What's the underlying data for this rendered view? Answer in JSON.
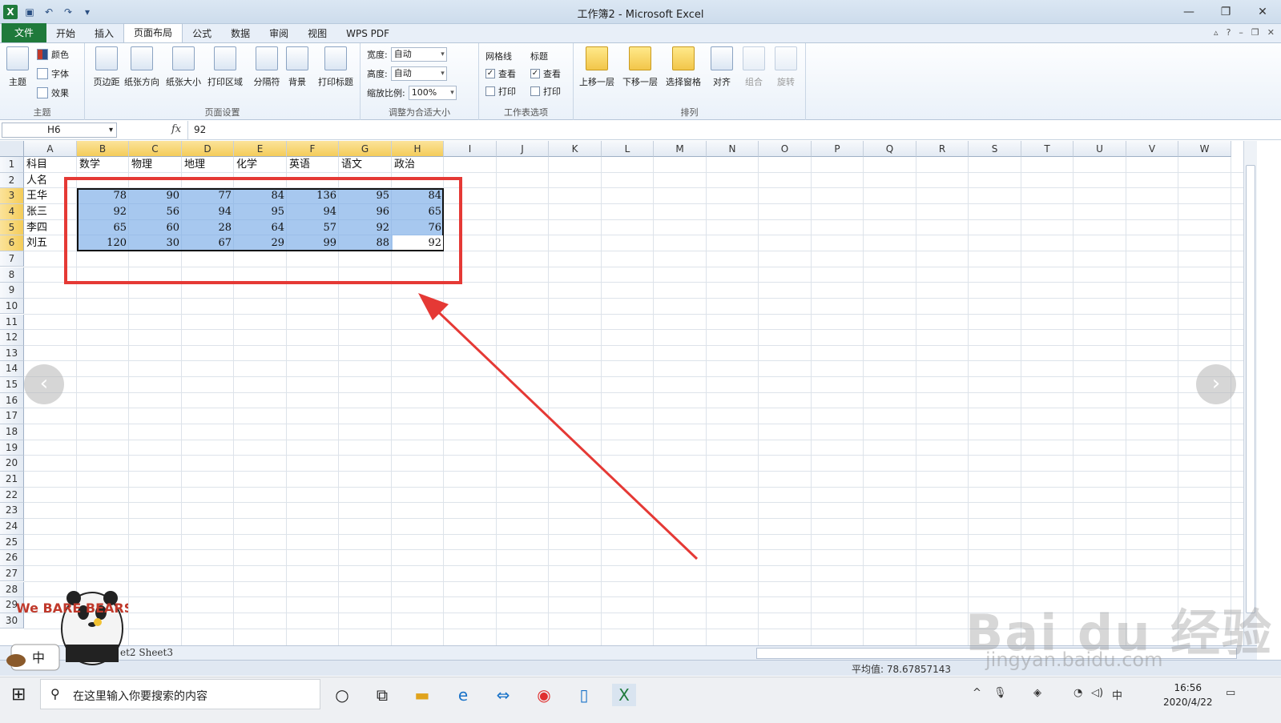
{
  "window": {
    "title": "工作簿2 - Microsoft Excel"
  },
  "ribbon_tabs": [
    "文件",
    "开始",
    "插入",
    "页面布局",
    "公式",
    "数据",
    "审阅",
    "视图",
    "WPS PDF"
  ],
  "ribbon": {
    "theme": {
      "big_label": "主题",
      "colors": "颜色",
      "fonts": "字体",
      "effects": "效果",
      "group_label": "主题"
    },
    "page_setup": {
      "buttons": [
        "页边距",
        "纸张方向",
        "纸张大小",
        "打印区域",
        "分隔符",
        "背景",
        "打印标题"
      ],
      "group_label": "页面设置"
    },
    "scale": {
      "width_label": "宽度:",
      "width_value": "自动",
      "height_label": "高度:",
      "height_value": "自动",
      "scale_label": "缩放比例:",
      "scale_value": "100%",
      "group_label": "调整为合适大小"
    },
    "sheet_options": {
      "gridlines": "网格线",
      "headings": "标题",
      "view": "查看",
      "print": "打印",
      "group_label": "工作表选项"
    },
    "arrange": {
      "buttons": [
        "上移一层",
        "下移一层",
        "选择窗格",
        "对齐",
        "组合",
        "旋转"
      ],
      "group_label": "排列"
    }
  },
  "formula_bar": {
    "name_box": "H6",
    "fx": "fx",
    "value": "92"
  },
  "columns": [
    "A",
    "B",
    "C",
    "D",
    "E",
    "F",
    "G",
    "H",
    "I",
    "J",
    "K",
    "L",
    "M",
    "N",
    "O",
    "P",
    "Q",
    "R",
    "S",
    "T",
    "U",
    "V",
    "W"
  ],
  "rows": [
    "1",
    "2",
    "3",
    "4",
    "5",
    "6",
    "7",
    "8",
    "9",
    "10",
    "11",
    "12",
    "13",
    "14",
    "15",
    "16",
    "17",
    "18",
    "19",
    "20",
    "21",
    "22",
    "23",
    "24",
    "25",
    "26",
    "27",
    "28",
    "29",
    "30"
  ],
  "sheet": {
    "header_row": [
      "科目",
      "数学",
      "物理",
      "地理",
      "化学",
      "英语",
      "语文",
      "政治"
    ],
    "row2_label": "人名",
    "data": [
      {
        "name": "王华",
        "values": [
          "78",
          "90",
          "77",
          "84",
          "136",
          "95",
          "84"
        ]
      },
      {
        "name": "张三",
        "values": [
          "92",
          "56",
          "94",
          "95",
          "94",
          "96",
          "65"
        ]
      },
      {
        "name": "李四",
        "values": [
          "65",
          "60",
          "28",
          "64",
          "57",
          "92",
          "76"
        ]
      },
      {
        "name": "刘五",
        "values": [
          "120",
          "30",
          "67",
          "29",
          "99",
          "88",
          "92"
        ]
      }
    ]
  },
  "sheet_tabs": "et2 Sheet3",
  "status_bar": {
    "average": "平均值: 78.67857143"
  },
  "taskbar": {
    "search_placeholder": "在这里输入你要搜索的内容",
    "time": "16:56",
    "date": "2020/4/22"
  },
  "watermark": {
    "brand": "Bai du 经验",
    "url": "jingyan.baidu.com"
  },
  "sticker": {
    "text": "We BARE BEARS",
    "ime": "中"
  },
  "colors": {
    "accent": "#1f7a3b",
    "selection": "#8fb9ea",
    "annotation_red": "#e53935"
  }
}
